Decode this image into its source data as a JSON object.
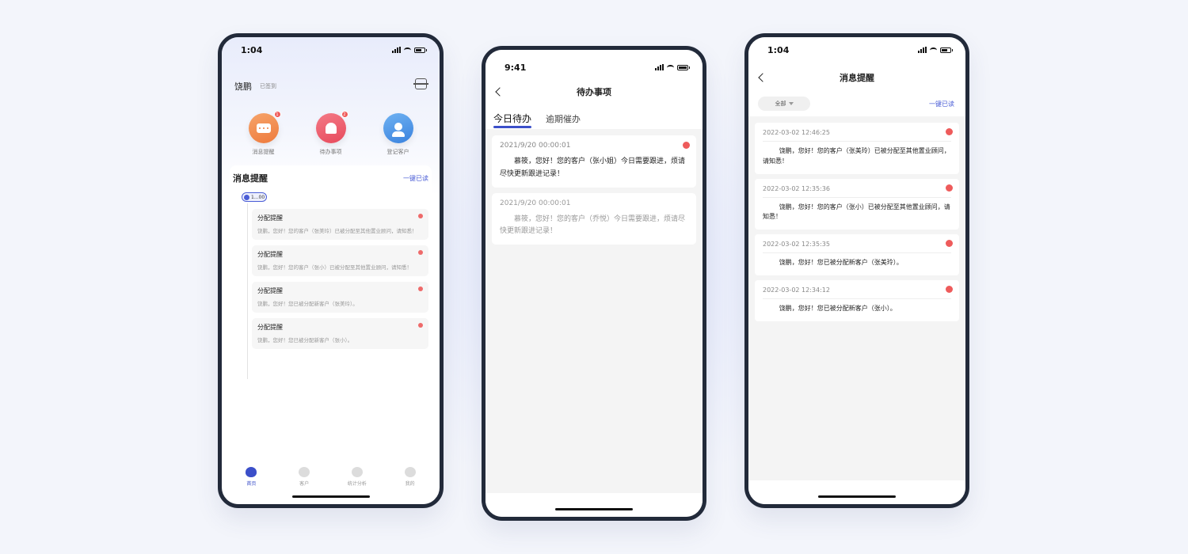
{
  "phone1": {
    "status": {
      "time": "1:04"
    },
    "user": {
      "name": "饶鹏",
      "status": "已签到"
    },
    "quick": [
      {
        "label": "消息提醒",
        "badge": "1",
        "color": "#f08a4b",
        "icon": "chat-bubble-icon"
      },
      {
        "label": "待办事项",
        "badge": "2",
        "color": "#ef5b6b",
        "icon": "bell-icon"
      },
      {
        "label": "登记客户",
        "color": "#4a90e2",
        "icon": "user-add-icon"
      }
    ],
    "panel": {
      "title": "消息提醒",
      "read_all": "一键已读",
      "time_chip": "1...00"
    },
    "notifications": [
      {
        "title": "分配提醒",
        "text": "饶鹏，您好！您的客户（张美玲）已被分配至其他置业顾问，请知悉！"
      },
      {
        "title": "分配提醒",
        "text": "饶鹏，您好！您的客户（张小）已被分配至其他置业顾问，请知悉！"
      },
      {
        "title": "分配提醒",
        "text": "饶鹏，您好！您已被分配新客户（张美玲）。"
      },
      {
        "title": "分配提醒",
        "text": "饶鹏，您好！您已被分配新客户（张小）。"
      }
    ],
    "tabbar": [
      {
        "label": "首页",
        "active": true
      },
      {
        "label": "客户"
      },
      {
        "label": "统计分析"
      },
      {
        "label": "我的"
      }
    ]
  },
  "phone2": {
    "status": {
      "time": "9:41"
    },
    "title": "待办事项",
    "tabs": [
      "今日待办",
      "逾期催办"
    ],
    "items": [
      {
        "time": "2021/9/20 00:00:01",
        "text": "慕筱，您好！您的客户（张小姐）今日需要跟进，烦请尽快更新跟进记录！",
        "unread": true
      },
      {
        "time": "2021/9/20 00:00:01",
        "text": "慕筱，您好！您的客户（乔悦）今日需要跟进，烦请尽快更新跟进记录！",
        "unread": false
      }
    ]
  },
  "phone3": {
    "status": {
      "time": "1:04"
    },
    "title": "消息提醒",
    "filter": "全部",
    "read_all": "一键已读",
    "messages": [
      {
        "time": "2022-03-02 12:46:25",
        "text": "饶鹏，您好！您的客户（张美玲）已被分配至其他置业顾问，请知悉！"
      },
      {
        "time": "2022-03-02 12:35:36",
        "text": "饶鹏，您好！您的客户（张小）已被分配至其他置业顾问，请知悉！"
      },
      {
        "time": "2022-03-02 12:35:35",
        "text": "饶鹏，您好！您已被分配新客户（张美玲）。"
      },
      {
        "time": "2022-03-02 12:34:12",
        "text": "饶鹏，您好！您已被分配新客户（张小）。"
      }
    ]
  },
  "colors": {
    "accent": "#3b4fc9",
    "unread_dot": "#ee5b5b",
    "frame": "#222a3a"
  }
}
